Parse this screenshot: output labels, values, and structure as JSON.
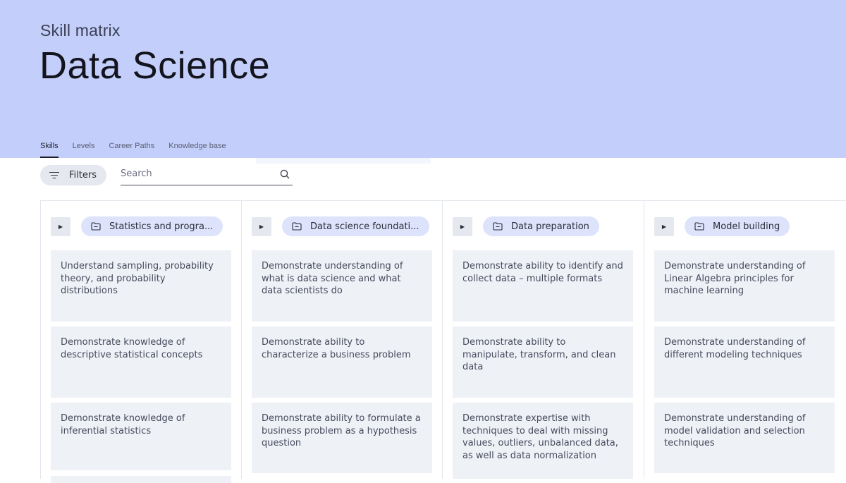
{
  "header": {
    "eyebrow": "Skill matrix",
    "title": "Data Science",
    "tabs": [
      {
        "label": "Skills",
        "active": true
      },
      {
        "label": "Levels",
        "active": false
      },
      {
        "label": "Career Paths",
        "active": false
      },
      {
        "label": "Knowledge base",
        "active": false
      }
    ],
    "background_color": "#c3cffa"
  },
  "toolbar": {
    "filters_label": "Filters",
    "search_placeholder": "Search"
  },
  "columns": [
    {
      "category": "Statistics and progra...",
      "cards": [
        "Understand sampling, probability theory, and probability distributions",
        "Demonstrate knowledge of descriptive statistical concepts",
        "Demonstrate knowledge of inferential statistics"
      ]
    },
    {
      "category": "Data science foundati...",
      "cards": [
        "Demonstrate understanding of what is data science and what data scientists do",
        "Demonstrate ability to characterize a business problem",
        "Demonstrate ability to formulate a business problem as a hypothesis question"
      ]
    },
    {
      "category": "Data preparation",
      "cards": [
        "Demonstrate ability to identify and collect data – multiple formats",
        "Demonstrate ability to manipulate, transform, and clean data",
        "Demonstrate expertise with techniques to deal with missing values, outliers, unbalanced data, as well as data normalization"
      ]
    },
    {
      "category": "Model building",
      "cards": [
        "Demonstrate understanding of Linear Algebra principles for machine learning",
        "Demonstrate understanding of different modeling techniques",
        "Demonstrate understanding of model validation and selection techniques"
      ]
    }
  ]
}
